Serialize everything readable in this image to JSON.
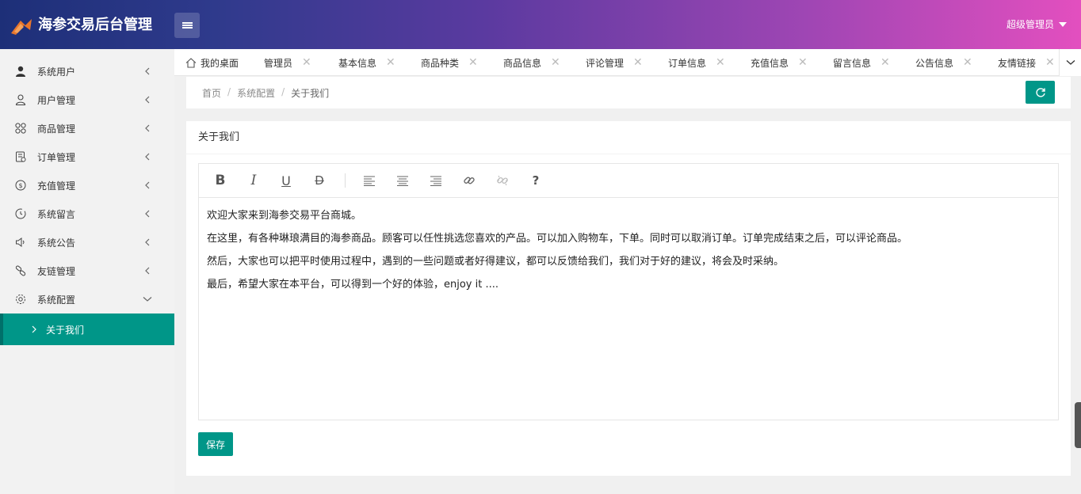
{
  "header": {
    "brand": "海参交易后台管理",
    "user_label": "超级管理员"
  },
  "sidebar": {
    "items": [
      {
        "label": "系统用户",
        "icon": "user-filled-icon"
      },
      {
        "label": "用户管理",
        "icon": "user-outline-icon"
      },
      {
        "label": "商品管理",
        "icon": "grid-icon"
      },
      {
        "label": "订单管理",
        "icon": "order-icon"
      },
      {
        "label": "充值管理",
        "icon": "dollar-icon"
      },
      {
        "label": "系统留言",
        "icon": "clock-icon"
      },
      {
        "label": "系统公告",
        "icon": "speaker-icon"
      },
      {
        "label": "友链管理",
        "icon": "link-icon"
      },
      {
        "label": "系统配置",
        "icon": "gear-icon"
      }
    ],
    "active_sub": "关于我们"
  },
  "tabs": [
    {
      "label": "我的桌面"
    },
    {
      "label": "管理员"
    },
    {
      "label": "基本信息"
    },
    {
      "label": "商品种类"
    },
    {
      "label": "商品信息"
    },
    {
      "label": "评论管理"
    },
    {
      "label": "订单信息"
    },
    {
      "label": "充值信息"
    },
    {
      "label": "留言信息"
    },
    {
      "label": "公告信息"
    },
    {
      "label": "友情链接"
    }
  ],
  "breadcrumb": {
    "home": "首页",
    "section": "系统配置",
    "current": "关于我们",
    "separator": "/"
  },
  "card": {
    "title": "关于我们",
    "toolbar": {
      "bold": "B",
      "italic": "I",
      "underline": "U",
      "strike": "D",
      "help": "?"
    },
    "content": [
      "欢迎大家来到海参交易平台商城。",
      "在这里，有各种琳琅满目的海参商品。顾客可以任性挑选您喜欢的产品。可以加入购物车，下单。同时可以取消订单。订单完成结束之后，可以评论商品。",
      "然后，大家也可以把平时使用过程中，遇到的一些问题或者好得建议，都可以反馈给我们，我们对于好的建议，将会及时采纳。",
      "最后，希望大家在本平台，可以得到一个好的体验，enjoy it ...."
    ],
    "save_label": "保存"
  },
  "colors": {
    "accent": "#009688",
    "header_gradient_start": "#1d2f78",
    "header_gradient_end": "#e34fbf"
  }
}
